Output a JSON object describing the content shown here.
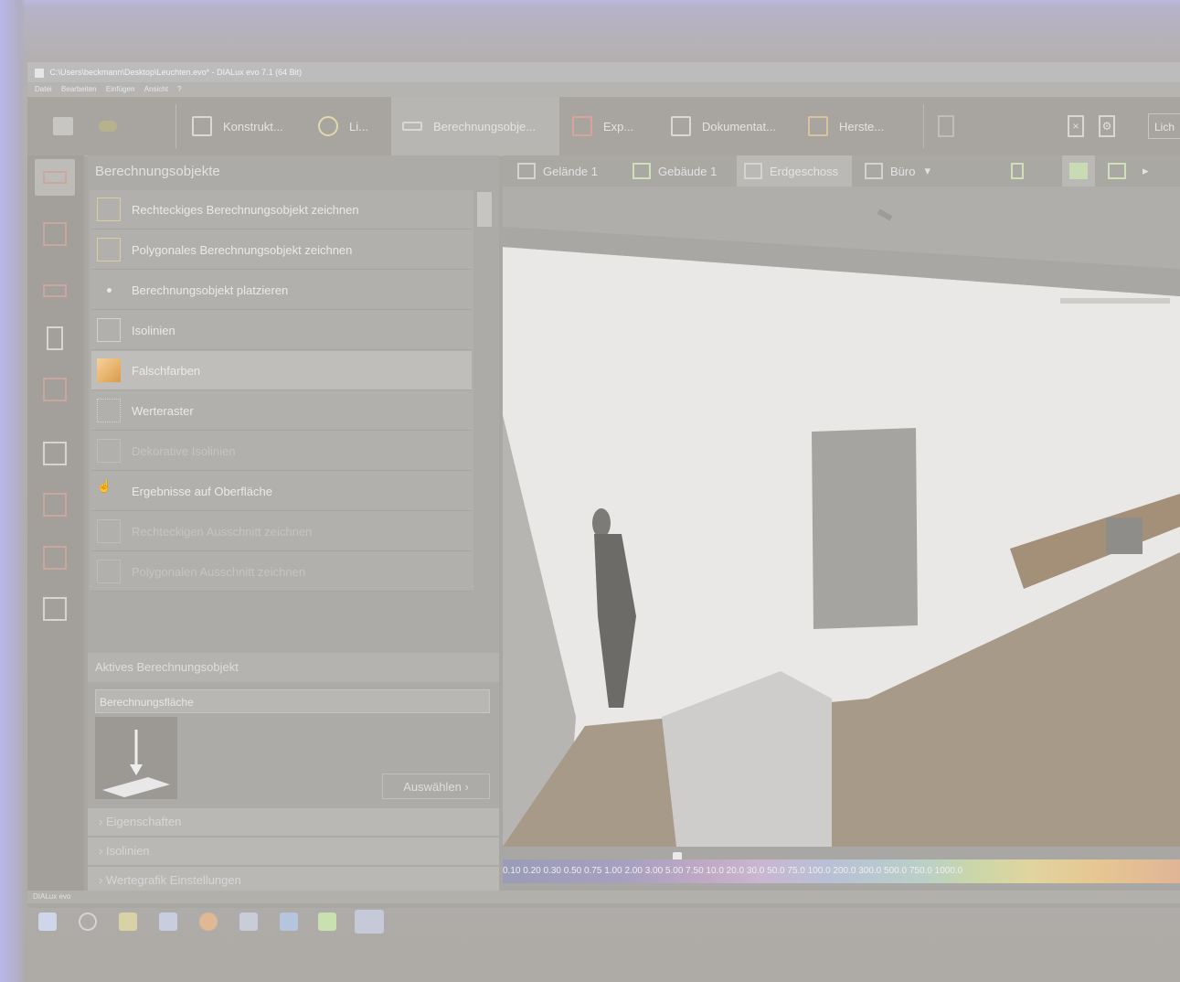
{
  "window": {
    "title": "C:\\Users\\beckmann\\Desktop\\Leuchten.evo* - DIALux evo 7.1 (64 Bit)"
  },
  "menu": [
    "Datei",
    "Bearbeiten",
    "Einfügen",
    "Ansicht",
    "?"
  ],
  "toolbar": {
    "tabs": [
      {
        "label": "Konstrukt...",
        "icon": "construction-icon"
      },
      {
        "label": "Li...",
        "icon": "light-icon"
      },
      {
        "label": "Berechnungsobje...",
        "icon": "calc-object-icon"
      },
      {
        "label": "Exp...",
        "icon": "export-icon"
      },
      {
        "label": "Dokumentat...",
        "icon": "document-icon"
      },
      {
        "label": "Herste...",
        "icon": "manufacturer-icon"
      }
    ],
    "licht_label": "Lich"
  },
  "panel": {
    "title": "Berechnungsobjekte",
    "items": [
      {
        "label": "Rechteckiges Berechnungsobjekt zeichnen",
        "state": "normal"
      },
      {
        "label": "Polygonales Berechnungsobjekt zeichnen",
        "state": "normal"
      },
      {
        "label": "Berechnungsobjekt platzieren",
        "state": "normal"
      },
      {
        "label": "Isolinien",
        "state": "normal"
      },
      {
        "label": "Falschfarben",
        "state": "selected"
      },
      {
        "label": "Werteraster",
        "state": "normal"
      },
      {
        "label": "Dekorative Isolinien",
        "state": "disabled"
      },
      {
        "label": "Ergebnisse auf Oberfläche",
        "state": "normal"
      },
      {
        "label": "Rechteckigen Ausschnitt zeichnen",
        "state": "disabled"
      },
      {
        "label": "Polygonalen Ausschnitt zeichnen",
        "state": "disabled"
      }
    ],
    "active_object_header": "Aktives Berechnungsobjekt",
    "active_object_name": "Berechnungsfläche",
    "select_button": "Auswählen",
    "accordions": [
      "Eigenschaften",
      "Isolinien",
      "Wertegrafik Einstellungen"
    ]
  },
  "viewbar": {
    "crumbs": [
      {
        "label": "Gelände 1"
      },
      {
        "label": "Gebäude 1"
      },
      {
        "label": "Erdgeschoss"
      },
      {
        "label": "Büro"
      }
    ]
  },
  "scale": {
    "label": "0.10 0.20 0.30 0.50 0.75 1.00 2.00 3.00 5.00 7.50 10.0 20.0 30.0 50.0 75.0 100.0 200.0 300.0 500.0 750.0 1000.0"
  },
  "status": {
    "text": "DIALux evo"
  },
  "taskbar": {
    "icons": [
      "windows-start-icon",
      "task-view-icon",
      "file-explorer-icon",
      "browser-icon",
      "firefox-icon",
      "chat-icon",
      "outlook-icon",
      "calculator-icon",
      "dialux-icon"
    ]
  }
}
